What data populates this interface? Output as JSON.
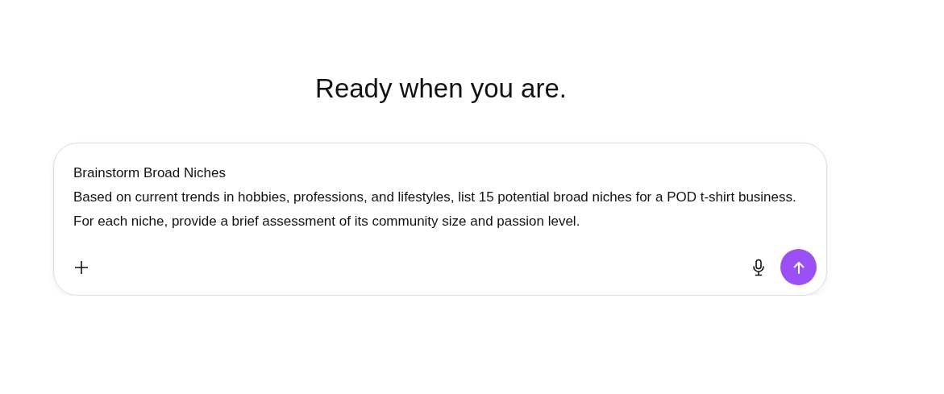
{
  "heading": "Ready when you are.",
  "composer": {
    "value": "Brainstorm Broad Niches\nBased on current trends in hobbies, professions, and lifestyles, list 15 potential broad niches for a POD t-shirt business. For each niche, provide a brief assessment of its community size and passion level."
  }
}
